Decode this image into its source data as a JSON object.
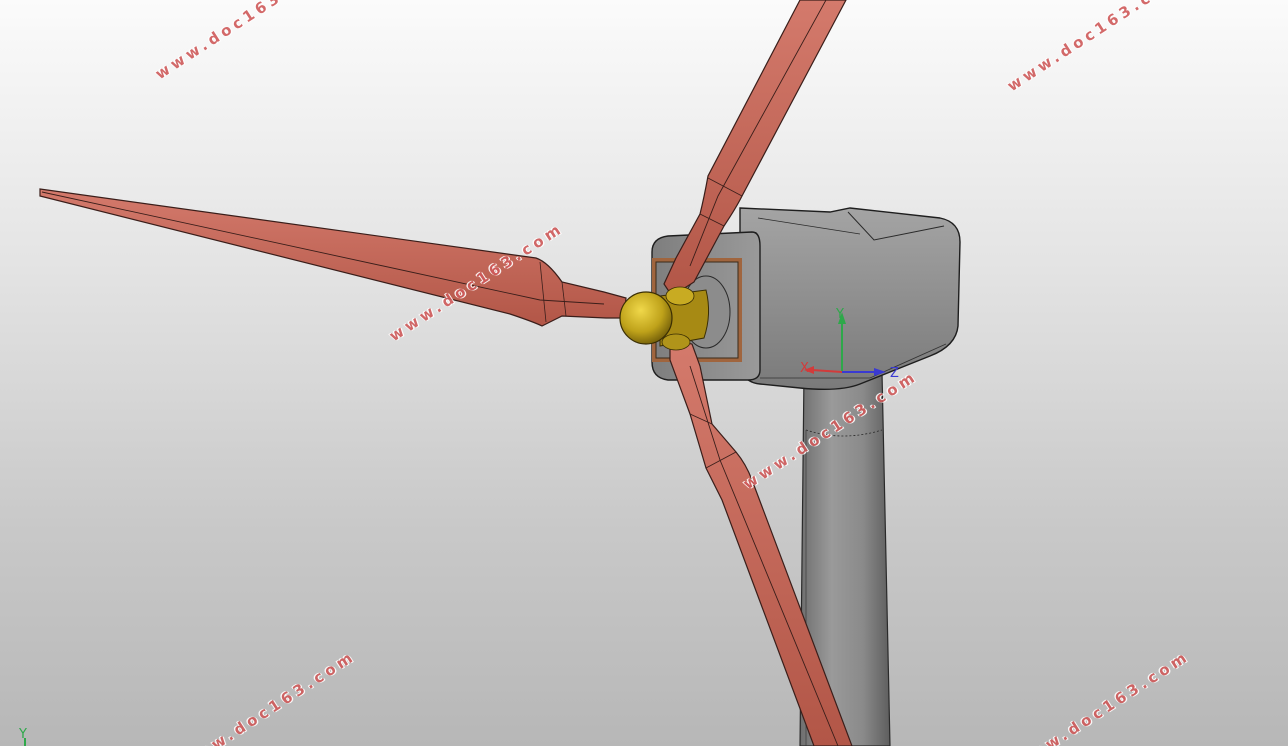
{
  "viewport": {
    "background_top": "#fbfbfb",
    "background_bottom": "#b7b7b7"
  },
  "model": {
    "blade_color": "#c8675a",
    "blade_edge_color": "#3a1e1a",
    "hub_color": "#bfa21a",
    "nacelle_color": "#8e8e8e",
    "tower_color": "#8a8a8a",
    "flange_color": "#a0653e"
  },
  "triad": {
    "x_label": "X",
    "y_label": "Y",
    "z_label": "Z",
    "x_color": "#d23b3b",
    "y_color": "#2ea84a",
    "z_color": "#3a3ad2"
  },
  "corner_triad": {
    "y_label": "Y",
    "y_color": "#2ea84a"
  },
  "watermarks": [
    "www.doc163.com",
    "www.doc163.com",
    "www.doc163.com",
    "www.doc163.com",
    "www.doc163.com",
    "www.doc163.com"
  ]
}
